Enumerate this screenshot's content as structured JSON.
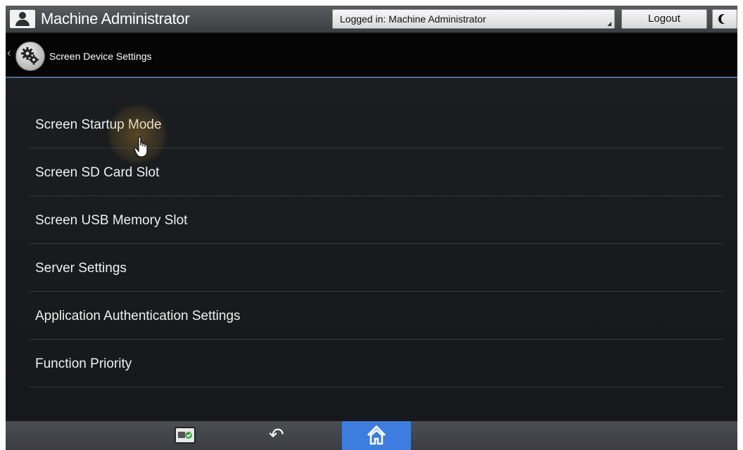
{
  "header": {
    "user_name": "Machine Administrator",
    "login_status": "Logged in: Machine Administrator",
    "logout_label": "Logout",
    "icons": [
      "user-icon",
      "moon-icon"
    ]
  },
  "titlebar": {
    "title": "Screen Device Settings",
    "back_glyph": "‹",
    "icon": "gear-icon"
  },
  "menu": {
    "items": [
      {
        "label": "Screen Startup Mode"
      },
      {
        "label": "Screen SD Card Slot"
      },
      {
        "label": "Screen USB Memory Slot"
      },
      {
        "label": "Server Settings"
      },
      {
        "label": "Application Authentication Settings"
      },
      {
        "label": "Function Priority"
      }
    ]
  },
  "footer": {
    "back_glyph": "↶",
    "icons": [
      "card-status-icon",
      "back-arrow-icon",
      "home-icon"
    ]
  },
  "colors": {
    "accent": "#3d7de0",
    "background": "#181a1d",
    "title_underline": "#4a6a8a"
  }
}
